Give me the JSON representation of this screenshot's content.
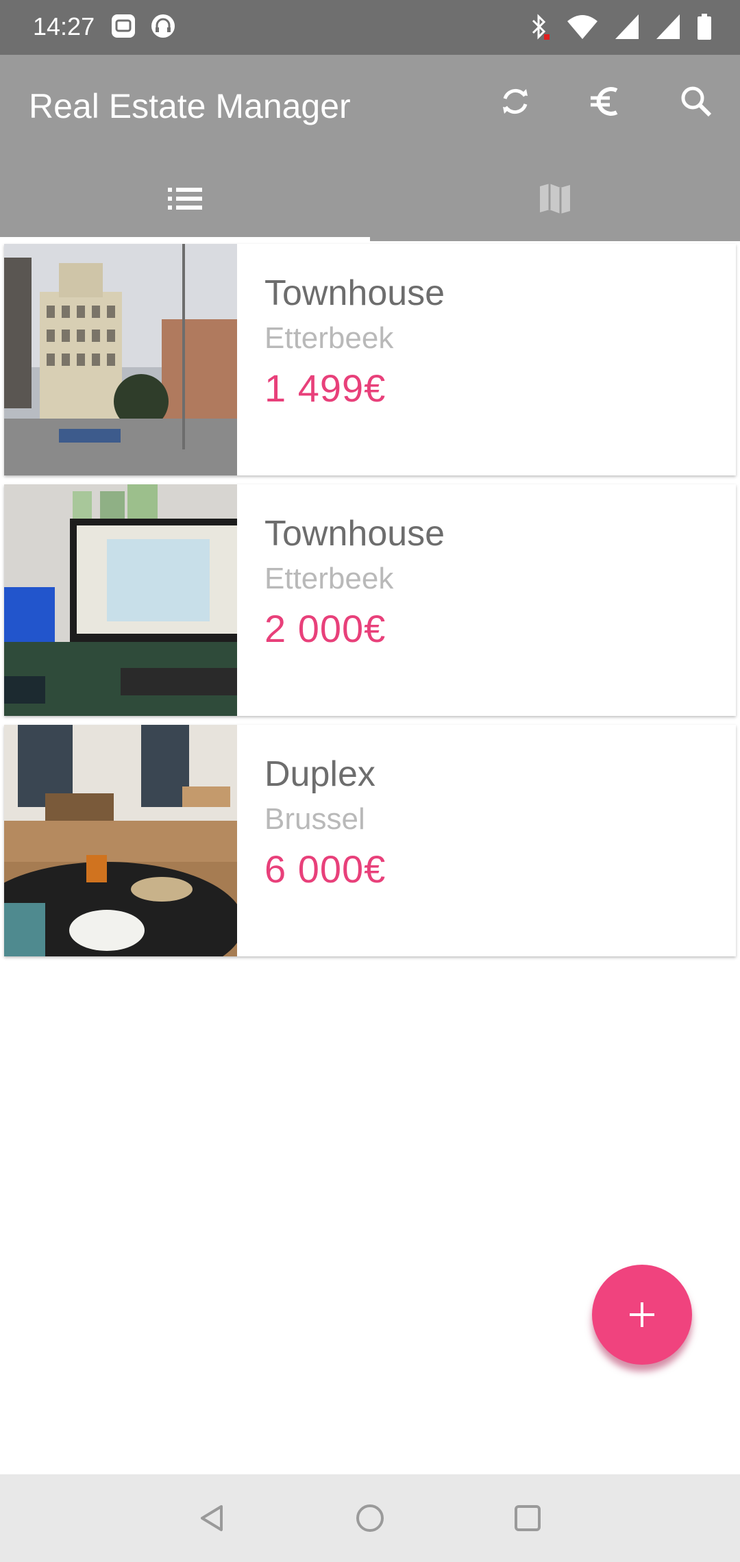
{
  "status_bar": {
    "time": "14:27",
    "left_icons": [
      "photo-notification-icon",
      "headset-notification-icon"
    ],
    "right_icons": [
      "bluetooth-icon",
      "wifi-icon",
      "signal-icon",
      "signal-icon",
      "battery-icon"
    ]
  },
  "app_bar": {
    "title": "Real Estate Manager",
    "actions": [
      {
        "name": "refresh-icon"
      },
      {
        "name": "currency-euro-icon"
      },
      {
        "name": "search-icon"
      }
    ],
    "tabs": [
      {
        "name": "list-icon",
        "active": true
      },
      {
        "name": "map-icon",
        "active": false
      }
    ]
  },
  "properties": [
    {
      "type": "Townhouse",
      "city": "Etterbeek",
      "price": "1 499€",
      "photo": "city-building-street-photo"
    },
    {
      "type": "Townhouse",
      "city": "Etterbeek",
      "price": "2 000€",
      "photo": "desk-computer-map-photo"
    },
    {
      "type": "Duplex",
      "city": "Brussel",
      "price": "6 000€",
      "photo": "living-room-dining-photo"
    }
  ],
  "fab": {
    "icon": "plus-icon"
  },
  "nav_bar": {
    "buttons": [
      "back-icon",
      "home-icon",
      "recents-icon"
    ]
  },
  "colors": {
    "status_bar": "#6f6f6f",
    "app_bar": "#9a9a9a",
    "accent": "#f0437e",
    "price": "#e8407a"
  }
}
